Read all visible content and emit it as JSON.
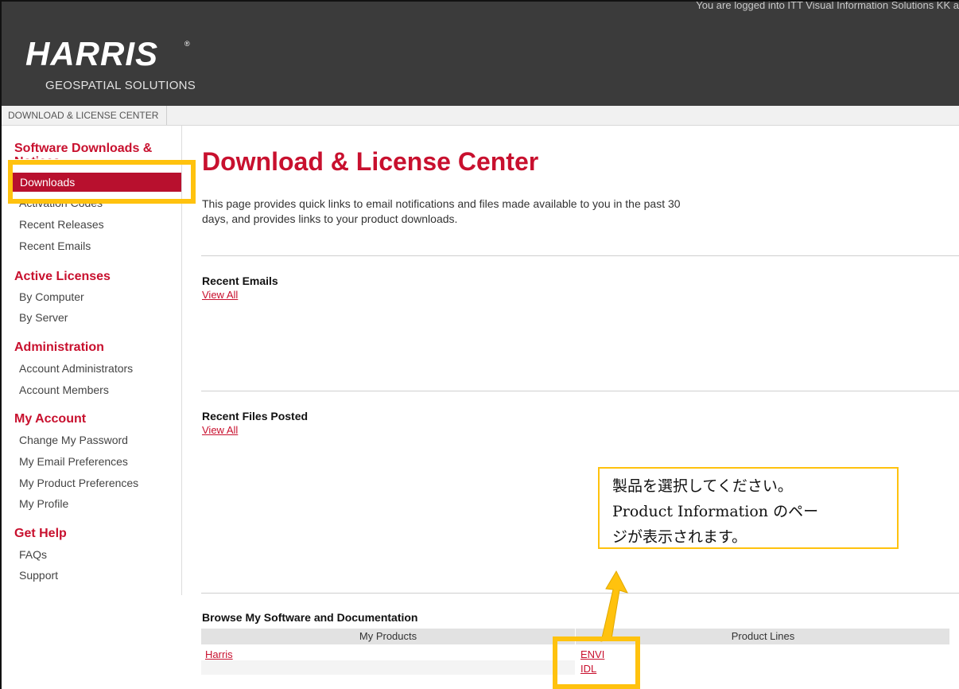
{
  "header": {
    "login_message": "You are logged into ITT Visual Information Solutions KK a",
    "logo_text": "HARRIS",
    "logo_sub": "GEOSPATIAL SOLUTIONS"
  },
  "breadcrumb": {
    "label": "DOWNLOAD & LICENSE CENTER"
  },
  "sidebar": {
    "groups": [
      {
        "heading": "Software Downloads & Notices",
        "items": [
          "Downloads",
          "Activation Codes",
          "Recent Releases",
          "Recent Emails"
        ]
      },
      {
        "heading": "Active Licenses",
        "items": [
          "By Computer",
          "By Server"
        ]
      },
      {
        "heading": "Administration",
        "items": [
          "Account Administrators",
          "Account Members"
        ]
      },
      {
        "heading": "My Account",
        "items": [
          "Change My Password",
          "My Email Preferences",
          "My Product Preferences",
          "My Profile"
        ]
      },
      {
        "heading": "Get Help",
        "items": [
          "FAQs",
          "Support"
        ]
      }
    ]
  },
  "main": {
    "title": "Download & License Center",
    "intro_line1": "This page provides quick links to email notifications and files made available to you in the past 30",
    "intro_line2": "days, and provides links to your product downloads.",
    "recent_emails": {
      "title": "Recent Emails",
      "link": "View All"
    },
    "recent_files": {
      "title": "Recent Files Posted",
      "link": "View All"
    },
    "browse": {
      "title": "Browse My Software and Documentation",
      "columns": [
        "My Products",
        "Product Lines"
      ],
      "products": [
        "Harris"
      ],
      "product_lines": [
        "ENVI",
        "IDL"
      ]
    }
  },
  "callout": {
    "line1": "製品を選択してください。",
    "line2": "Product Information のペー",
    "line3": "ジが表示されます。"
  },
  "colors": {
    "accent": "#c8102e",
    "highlight": "#ffc20e",
    "header_bg": "#3b3b3b"
  }
}
